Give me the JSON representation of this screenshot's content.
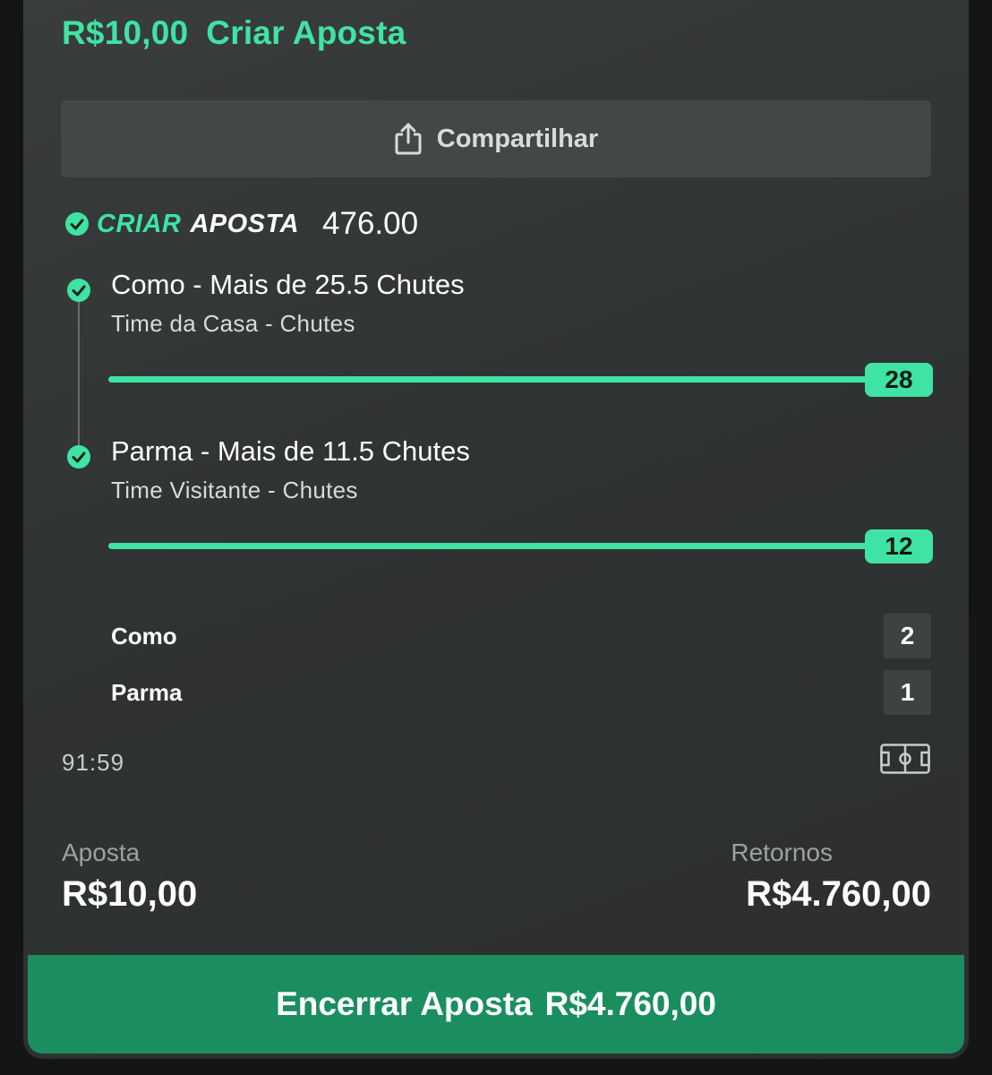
{
  "header": {
    "stake": "R$10,00",
    "title": "Criar Aposta"
  },
  "share": {
    "label": "Compartilhar",
    "icon": "share-icon"
  },
  "bet_builder": {
    "logo_part1": "CRIAR",
    "logo_part2": "APOSTA",
    "odds": "476.00",
    "check_icon": "check-circle-icon",
    "accent_color": "#3fe3a4"
  },
  "legs": [
    {
      "title": "Como - Mais de 25.5 Chutes",
      "subtitle": "Time da Casa - Chutes",
      "progress_value": "28",
      "progress_fraction": 1.0
    },
    {
      "title": "Parma - Mais de 11.5 Chutes",
      "subtitle": "Time Visitante - Chutes",
      "progress_value": "12",
      "progress_fraction": 1.0
    }
  ],
  "scoreboard": {
    "teams": [
      {
        "name": "Como",
        "score": "2"
      },
      {
        "name": "Parma",
        "score": "1"
      }
    ],
    "clock": "91:59",
    "pitch_icon": "pitch-icon"
  },
  "summary": {
    "stake_label": "Aposta",
    "stake_value": "R$10,00",
    "returns_label": "Retornos",
    "returns_value": "R$4.760,00"
  },
  "cashout": {
    "label": "Encerrar Aposta",
    "amount": "R$4.760,00",
    "color": "#1b8e60"
  }
}
